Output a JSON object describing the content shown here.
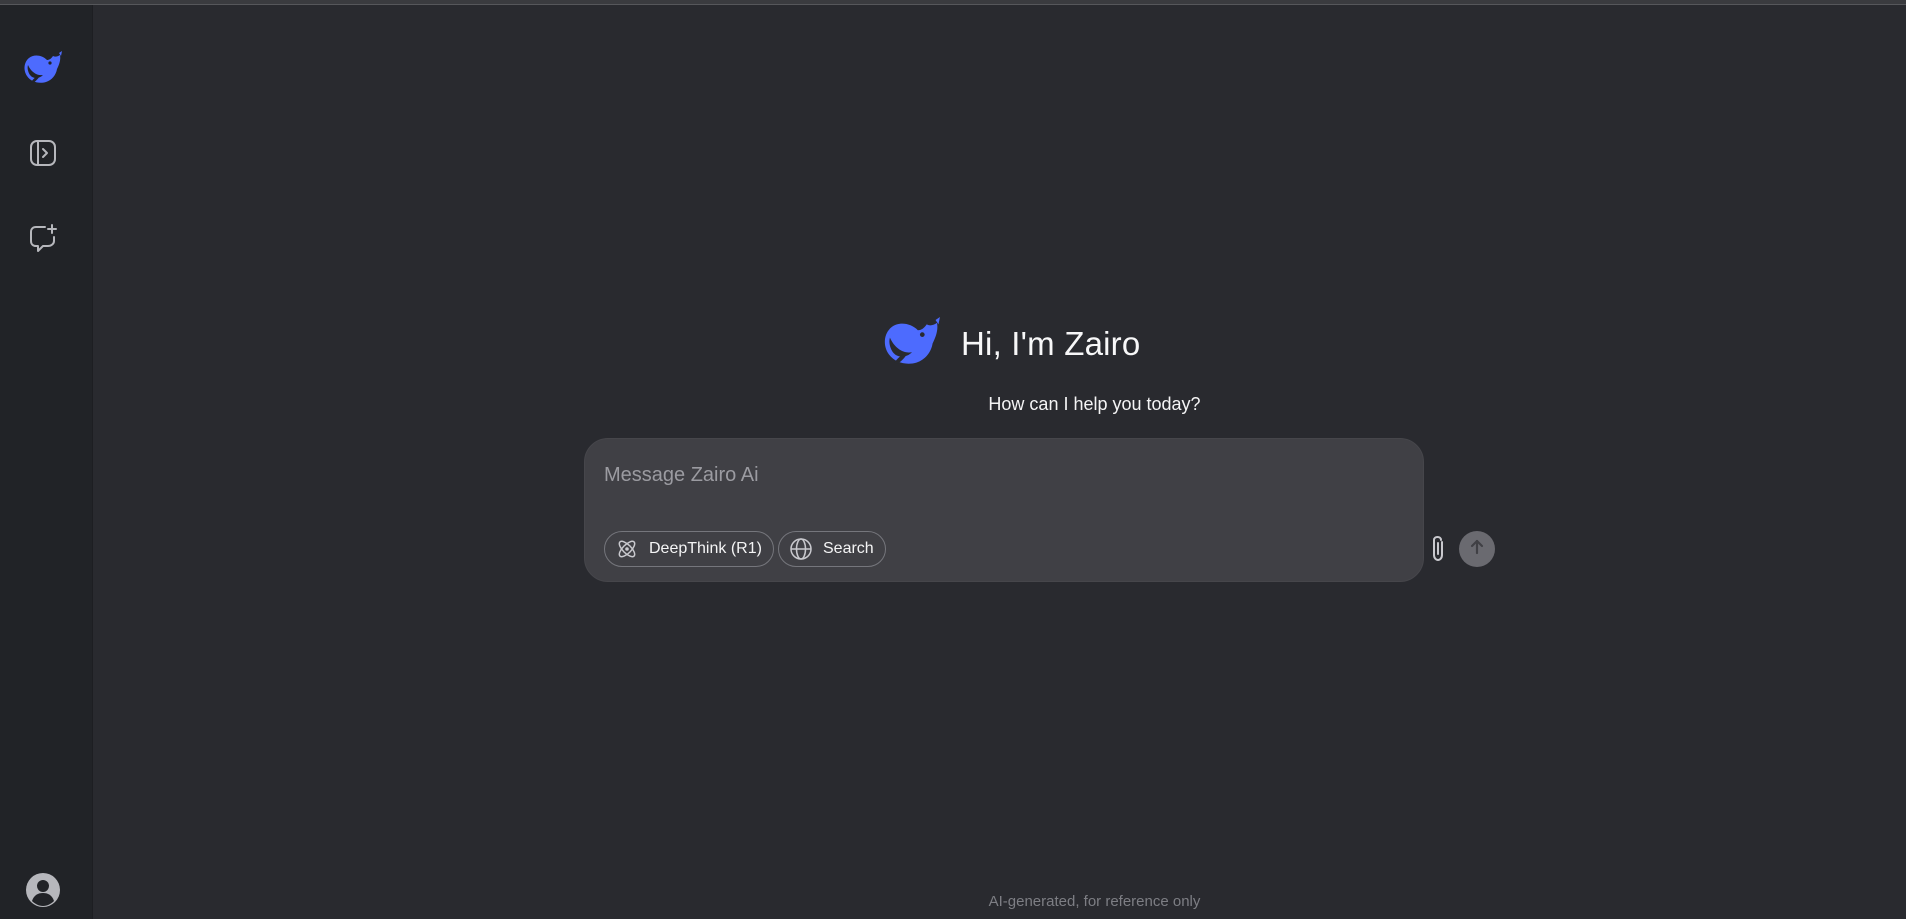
{
  "app": {
    "brand_color": "#4d6bfe"
  },
  "sidebar": {
    "items": [
      {
        "name": "logo",
        "icon": "whale-logo-icon"
      },
      {
        "name": "open-sidebar",
        "icon": "sidebar-panel-icon"
      },
      {
        "name": "new-chat",
        "icon": "new-chat-icon"
      },
      {
        "name": "profile",
        "icon": "user-avatar-icon"
      }
    ]
  },
  "hero": {
    "title": "Hi, I'm Zairo",
    "subtitle": "How can I help you today?"
  },
  "composer": {
    "placeholder": "Message Zairo Ai",
    "value": "",
    "deepthink_label": "DeepThink (R1)",
    "search_label": "Search",
    "attach_icon": "paperclip-icon",
    "send_icon": "arrow-up-icon"
  },
  "footer": {
    "note": "AI-generated, for reference only"
  }
}
